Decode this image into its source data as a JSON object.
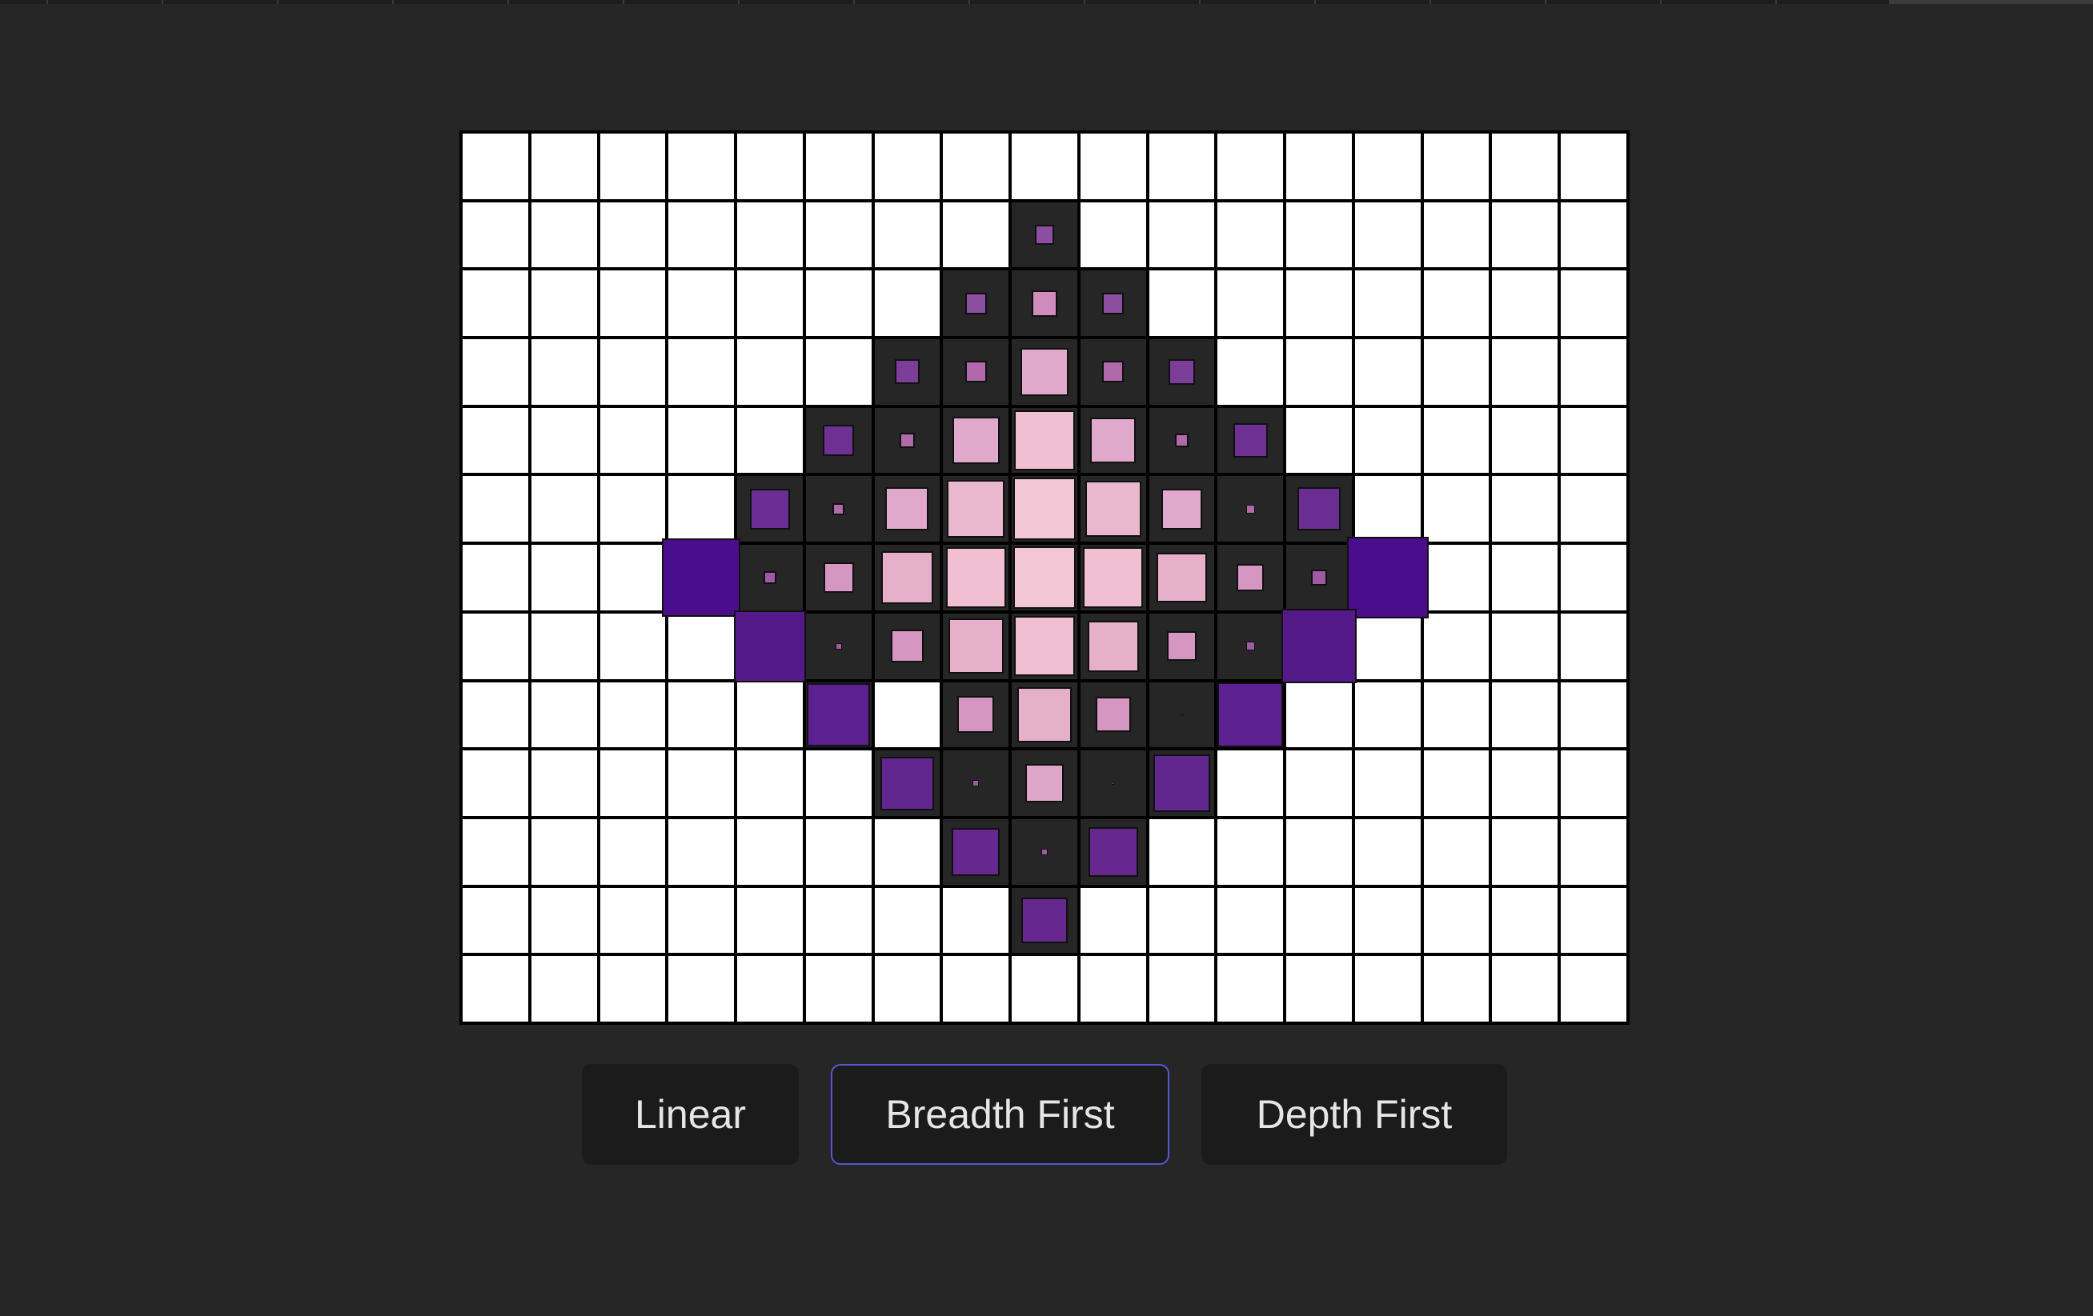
{
  "grid": {
    "rows": 13,
    "cols": 17,
    "cell_color": "#ffffff",
    "visited_background": "#262626",
    "marks": [
      [
        1,
        8,
        0.3,
        "#8b4ea0"
      ],
      [
        2,
        7,
        0.33,
        "#8b4ea0"
      ],
      [
        2,
        8,
        0.4,
        "#d08cbc"
      ],
      [
        2,
        9,
        0.33,
        "#8b4ea0"
      ],
      [
        3,
        6,
        0.38,
        "#7c3e98"
      ],
      [
        3,
        7,
        0.33,
        "#b06aa9"
      ],
      [
        3,
        8,
        0.74,
        "#e0a8cb"
      ],
      [
        3,
        9,
        0.33,
        "#b06aa9"
      ],
      [
        3,
        10,
        0.4,
        "#7c3e98"
      ],
      [
        4,
        5,
        0.48,
        "#6d3193"
      ],
      [
        4,
        6,
        0.24,
        "#b06aa9"
      ],
      [
        4,
        7,
        0.72,
        "#e0a8cb"
      ],
      [
        4,
        8,
        0.92,
        "#f0c0d2"
      ],
      [
        4,
        9,
        0.7,
        "#e0a8cb"
      ],
      [
        4,
        10,
        0.2,
        "#b06aa9"
      ],
      [
        4,
        11,
        0.52,
        "#6d3193"
      ],
      [
        5,
        4,
        0.62,
        "#6a2e92"
      ],
      [
        5,
        5,
        0.18,
        "#b06aa9"
      ],
      [
        5,
        6,
        0.66,
        "#e0a8cb"
      ],
      [
        5,
        7,
        0.88,
        "#eab8ce"
      ],
      [
        5,
        8,
        0.95,
        "#f2c6d5"
      ],
      [
        5,
        9,
        0.86,
        "#eab8ce"
      ],
      [
        5,
        10,
        0.62,
        "#e0a8cb"
      ],
      [
        5,
        11,
        0.14,
        "#b06aa9"
      ],
      [
        5,
        12,
        0.66,
        "#6a2e92"
      ],
      [
        6,
        3,
        1.2,
        "#4a0d8c"
      ],
      [
        6,
        4,
        0.2,
        "#a05aa5"
      ],
      [
        6,
        5,
        0.46,
        "#d696c2"
      ],
      [
        6,
        6,
        0.8,
        "#e6b0ca"
      ],
      [
        6,
        7,
        0.92,
        "#f0c0d2"
      ],
      [
        6,
        8,
        0.96,
        "#f2c6d5"
      ],
      [
        6,
        9,
        0.92,
        "#f0c0d2"
      ],
      [
        6,
        10,
        0.76,
        "#e6b0ca"
      ],
      [
        6,
        11,
        0.42,
        "#d696c2"
      ],
      [
        6,
        12,
        0.24,
        "#a05aa5"
      ],
      [
        6,
        13,
        1.24,
        "#4a0d8c"
      ],
      [
        7,
        4,
        1.1,
        "#541a8a"
      ],
      [
        7,
        5,
        0.1,
        "#a05aa5"
      ],
      [
        7,
        6,
        0.5,
        "#d696c2"
      ],
      [
        7,
        7,
        0.84,
        "#e6b0ca"
      ],
      [
        7,
        8,
        0.92,
        "#f0c0d2"
      ],
      [
        7,
        9,
        0.78,
        "#e6b0ca"
      ],
      [
        7,
        10,
        0.46,
        "#d696c2"
      ],
      [
        7,
        11,
        0.14,
        "#a05aa5"
      ],
      [
        7,
        12,
        1.14,
        "#541a8a"
      ],
      [
        8,
        5,
        0.96,
        "#5c2090"
      ],
      [
        8,
        7,
        0.56,
        "#d696c2"
      ],
      [
        8,
        8,
        0.84,
        "#e6b0ca"
      ],
      [
        8,
        9,
        0.54,
        "#d696c2"
      ],
      [
        8,
        10,
        0.04,
        "#a05aa5"
      ],
      [
        8,
        11,
        1.0,
        "#5c2090"
      ],
      [
        9,
        6,
        0.82,
        "#62278f"
      ],
      [
        9,
        7,
        0.1,
        "#a05aa5"
      ],
      [
        9,
        8,
        0.58,
        "#dea6c8"
      ],
      [
        9,
        9,
        0.04,
        "#a05aa5"
      ],
      [
        9,
        10,
        0.88,
        "#62278f"
      ],
      [
        10,
        7,
        0.74,
        "#66288e"
      ],
      [
        10,
        8,
        0.1,
        "#a05aa5"
      ],
      [
        10,
        9,
        0.76,
        "#66288e"
      ],
      [
        11,
        8,
        0.7,
        "#66288e"
      ]
    ]
  },
  "buttons": [
    {
      "label": "Linear",
      "active": false
    },
    {
      "label": "Breadth First",
      "active": true
    },
    {
      "label": "Depth First",
      "active": false
    }
  ],
  "colors": {
    "background": "#262626",
    "button_bg": "#1b1b1b",
    "button_text": "#e6e6e6",
    "active_border": "#5856d6"
  }
}
